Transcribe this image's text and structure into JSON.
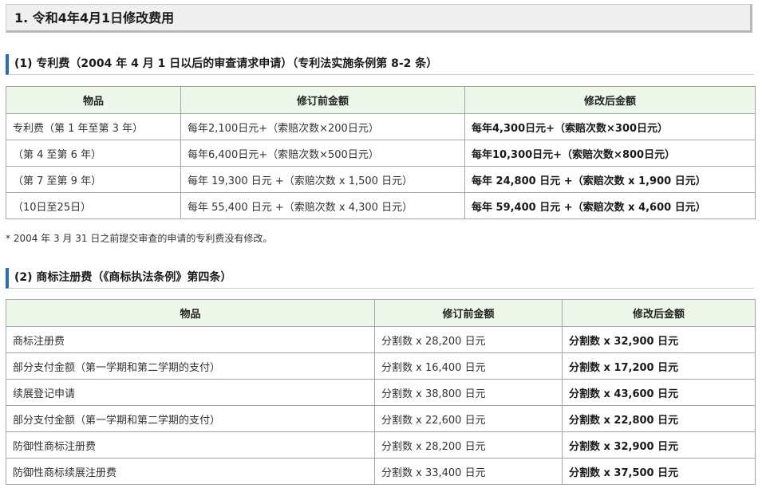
{
  "page_title": "1. 令和4年4月1日修改费用",
  "patent": {
    "heading": "(1) 专利费（2004 年 4 月 1 日以后的审查请求申请）（专利法实施条例第 8-2 条）",
    "headers": [
      "物品",
      "修订前金额",
      "修改后金额"
    ],
    "rows": [
      [
        "专利费（第 1 年至第 3 年）",
        "每年2,100日元+（索赔次数×200日元）",
        "每年4,300日元+（索赔次数×300日元）"
      ],
      [
        "（第 4 至第 6 年）",
        "每年6,400日元+（索赔次数×500日元）",
        "每年10,300日元+（索赔次数×800日元）"
      ],
      [
        "（第 7 至第 9 年）",
        "每年 19,300 日元 +（索赔次数 x 1,500 日元）",
        "每年 24,800 日元 +（索赔次数 x 1,900 日元）"
      ],
      [
        "（10日至25日）",
        "每年 55,400 日元 +（索赔次数 x 4,300 日元）",
        "每年 59,400 日元 +（索赔次数 x 4,600 日元）"
      ]
    ],
    "note": "* 2004 年 3 月 31 日之前提交审查的申请的专利费没有修改。"
  },
  "trademark": {
    "heading": "(2) 商标注册费（《商标执法条例》第四条）",
    "headers": [
      "物品",
      "修订前金额",
      "修改后金额"
    ],
    "rows": [
      [
        "商标注册费",
        "分割数 x 28,200 日元",
        "分割数 x 32,900 日元"
      ],
      [
        "部分支付金额（第一学期和第二学期的支付）",
        "分割数 x 16,400 日元",
        "分割数 x 17,200 日元"
      ],
      [
        "续展登记申请",
        "分割数 x 38,800 日元",
        "分割数 x 43,600 日元"
      ],
      [
        "部分支付金额（第一学期和第二学期的支付）",
        "分割数 x 22,600 日元",
        "分割数 x 22,800 日元"
      ],
      [
        "防御性商标注册费",
        "分割数 x 28,200 日元",
        "分割数 x 32,900 日元"
      ],
      [
        "防御性商标续展注册费",
        "分割数 x 33,400 日元",
        "分割数 x 37,500 日元"
      ]
    ]
  }
}
